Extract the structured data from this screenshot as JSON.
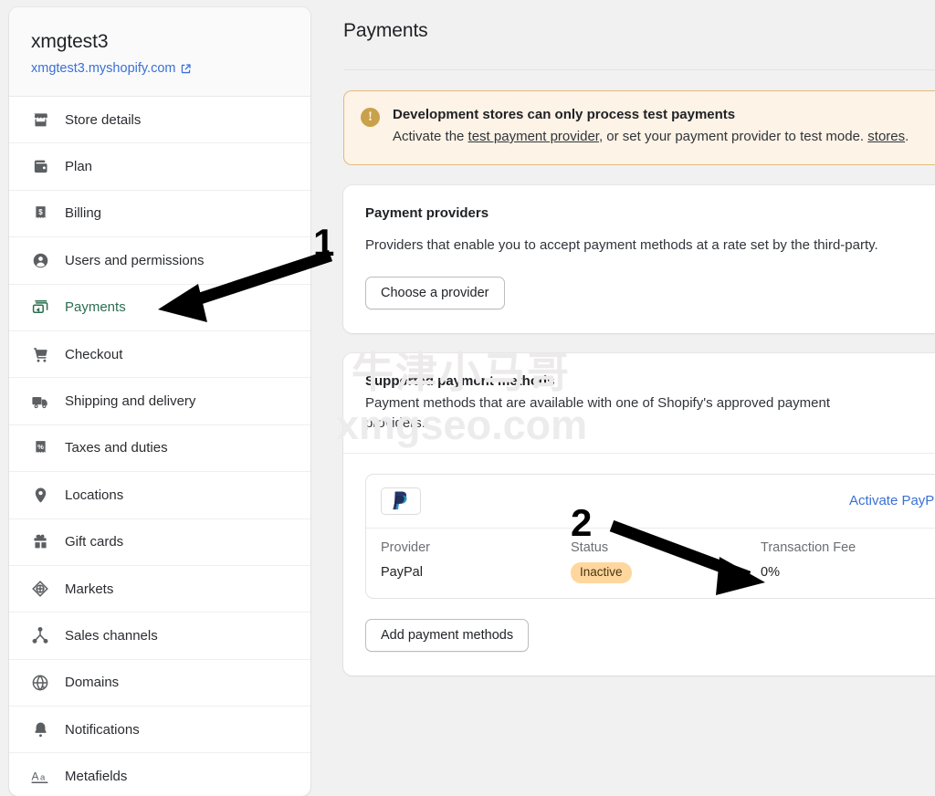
{
  "sidebar": {
    "store_name": "xmgtest3",
    "store_url": "xmgtest3.myshopify.com",
    "external_link_icon": "external-link-icon",
    "items": [
      {
        "label": "Store details",
        "icon": "store-icon",
        "active": false
      },
      {
        "label": "Plan",
        "icon": "wallet-icon",
        "active": false
      },
      {
        "label": "Billing",
        "icon": "receipt-dollar-icon",
        "active": false
      },
      {
        "label": "Users and permissions",
        "icon": "user-circle-icon",
        "active": false
      },
      {
        "label": "Payments",
        "icon": "payment-card-icon",
        "active": true
      },
      {
        "label": "Checkout",
        "icon": "shopping-cart-icon",
        "active": false
      },
      {
        "label": "Shipping and delivery",
        "icon": "delivery-truck-icon",
        "active": false
      },
      {
        "label": "Taxes and duties",
        "icon": "receipt-percent-icon",
        "active": false
      },
      {
        "label": "Locations",
        "icon": "map-pin-icon",
        "active": false
      },
      {
        "label": "Gift cards",
        "icon": "gift-icon",
        "active": false
      },
      {
        "label": "Markets",
        "icon": "globe-target-icon",
        "active": false
      },
      {
        "label": "Sales channels",
        "icon": "channels-icon",
        "active": false
      },
      {
        "label": "Domains",
        "icon": "globe-icon",
        "active": false
      },
      {
        "label": "Notifications",
        "icon": "bell-icon",
        "active": false
      },
      {
        "label": "Metafields",
        "icon": "text-aa-icon",
        "active": false
      }
    ]
  },
  "main": {
    "page_title": "Payments",
    "banner": {
      "icon": "warning-exclamation-icon",
      "title": "Development stores can only process test payments",
      "text_before_link": "Activate the ",
      "link_text": "test payment provider",
      "text_after_link": ", or set your payment provider to test mode. ",
      "link_text_2": "stores",
      "text_end": "."
    },
    "payment_providers": {
      "title": "Payment providers",
      "description": "Providers that enable you to accept payment methods at a rate set by the third-party.",
      "button_label": "Choose a provider"
    },
    "supported_payment_methods": {
      "title": "Supported payment methods",
      "description": "Payment methods that are available with one of Shopify's approved payment providers.",
      "activate_link": "Activate PayPal",
      "paypal_logo_icon": "paypal-logo-icon",
      "columns": [
        "Provider",
        "Status",
        "Transaction Fee"
      ],
      "row": {
        "provider": "PayPal",
        "status": "Inactive",
        "transaction_fee": "0%"
      },
      "add_button_label": "Add payment methods"
    }
  },
  "annotations": {
    "marker_one": "1",
    "marker_two": "2"
  },
  "watermark": {
    "chinese": "牛津小马哥",
    "url": "xmgseo.com"
  },
  "colors": {
    "accent_green": "#2c6e4f",
    "link_blue": "#3a70d6",
    "banner_bg": "#fdf3e6",
    "banner_border": "#e0bb7a",
    "banner_icon": "#c9a14a",
    "badge_bg": "#ffd79d",
    "page_bg": "#f1f1f1"
  }
}
